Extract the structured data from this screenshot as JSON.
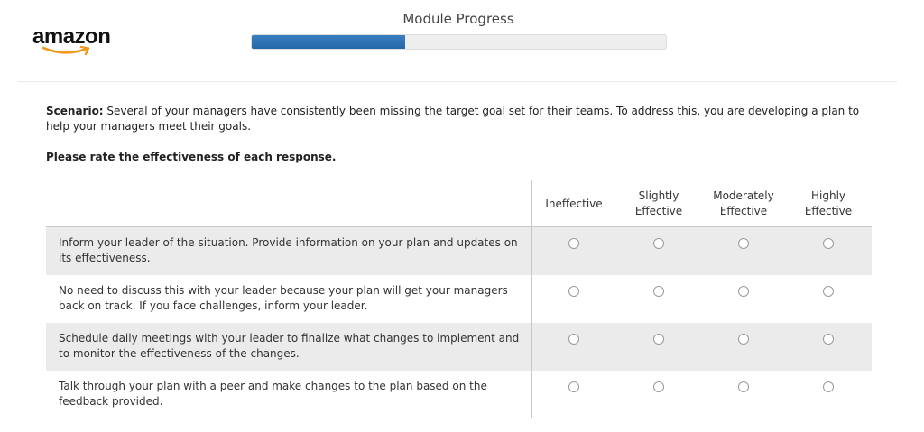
{
  "header": {
    "logo_text": "amazon",
    "progress_title": "Module Progress",
    "progress_fraction": 0.37
  },
  "scenario": {
    "label": "Scenario:",
    "text": " Several of your managers have consistently been missing the target goal set for their teams. To address this, you are developing a plan to help your managers meet their goals."
  },
  "instruction": "Please rate the effectiveness of each response.",
  "rating_columns": [
    "Ineffective",
    "Slightly Effective",
    "Moderately Effective",
    "Highly Effective"
  ],
  "responses": [
    "Inform your leader of the situation. Provide information on your plan and updates on its effectiveness.",
    "No need to discuss this with your leader because your plan will get your managers back on track. If you face challenges, inform your leader.",
    "Schedule daily meetings with your leader to finalize what changes to implement and to monitor the effectiveness of the changes.",
    "Talk through your plan with a peer and make changes to the plan based on the feedback provided."
  ],
  "colors": {
    "progress_fill": "#2b6cab",
    "row_shade": "#ebebeb"
  }
}
